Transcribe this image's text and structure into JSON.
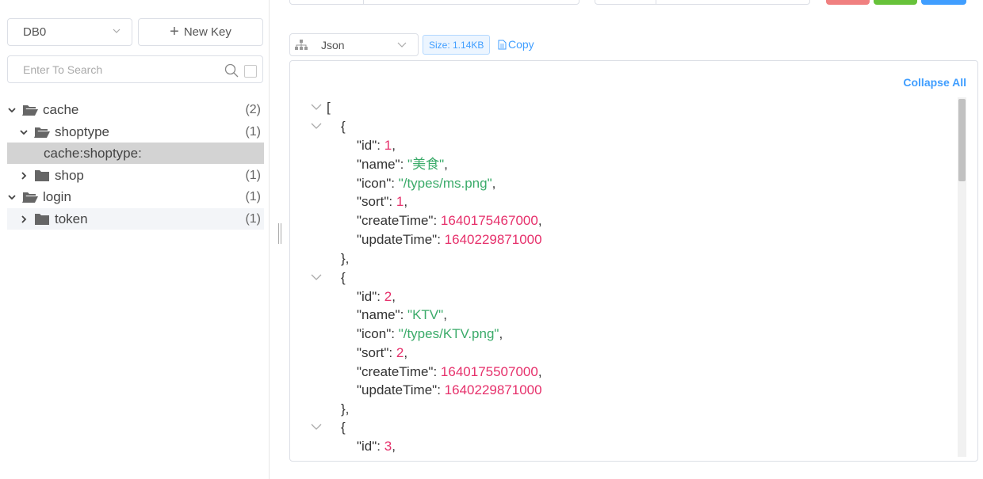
{
  "sidebar": {
    "db_selected": "DB0",
    "new_key_label": "New Key",
    "search_placeholder": "Enter To Search",
    "tree": [
      {
        "label": "cache",
        "count": "(2)",
        "type": "folder-open",
        "expanded": true,
        "level": 0
      },
      {
        "label": "shoptype",
        "count": "(1)",
        "type": "folder-open",
        "expanded": true,
        "level": 1
      },
      {
        "label": "cache:shoptype:",
        "count": "",
        "type": "key",
        "level": 2,
        "selected": true
      },
      {
        "label": "shop",
        "count": "(1)",
        "type": "folder",
        "expanded": false,
        "level": 1
      },
      {
        "label": "login",
        "count": "(1)",
        "type": "folder-open",
        "expanded": true,
        "level": 0
      },
      {
        "label": "token",
        "count": "(1)",
        "type": "folder",
        "expanded": false,
        "level": 1
      }
    ]
  },
  "viewer": {
    "format_selected": "Json",
    "size_label": "Size: 1.14KB",
    "copy_label": "Copy",
    "collapse_all_label": "Collapse All",
    "json_items": [
      {
        "id": "1",
        "name": "\"美食\"",
        "icon": "\"/types/ms.png\"",
        "sort": "1",
        "createTime": "1640175467000",
        "updateTime": "1640229871000"
      },
      {
        "id": "2",
        "name": "\"KTV\"",
        "icon": "\"/types/KTV.png\"",
        "sort": "2",
        "createTime": "1640175507000",
        "updateTime": "1640229871000"
      },
      {
        "id": "3"
      }
    ]
  },
  "colors": {
    "accent": "#409eff",
    "string": "#3bab6a",
    "number": "#e6306b",
    "selected_row": "#d3d3d3",
    "btn_red": "#f56c6c",
    "btn_green": "#67c23a",
    "btn_blue": "#409eff"
  }
}
